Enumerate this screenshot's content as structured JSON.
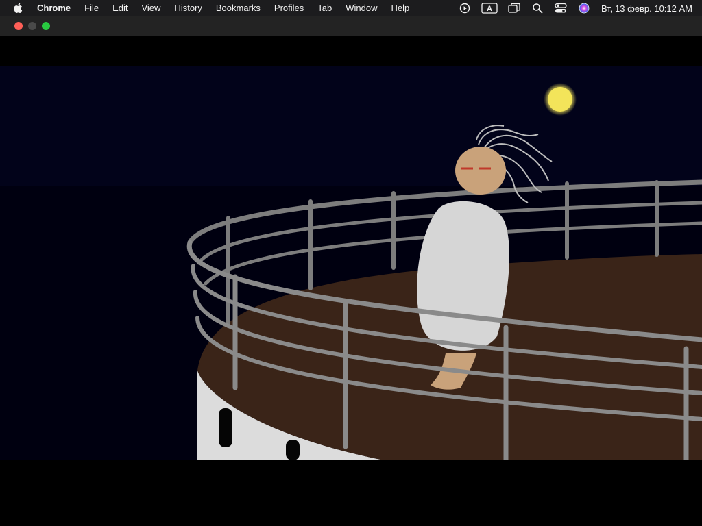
{
  "menubar": {
    "apple_icon": "apple-logo-icon",
    "app_name": "Chrome",
    "items": [
      "File",
      "Edit",
      "View",
      "History",
      "Bookmarks",
      "Profiles",
      "Tab",
      "Window",
      "Help"
    ],
    "status_icons": [
      "play-circle-icon",
      "keyboard-input-icon",
      "screen-mirroring-icon",
      "search-icon",
      "control-center-icon",
      "siri-icon"
    ],
    "input_indicator": "A",
    "clock": "Вт, 13 февр.  10:12 AM"
  },
  "window": {
    "traffic_lights": {
      "close": "#ff5f57",
      "minimize": "#4a4a4a",
      "zoom": "#28c840"
    }
  },
  "scene": {
    "description_icon": "titanic-ship-bow-scene",
    "colors": {
      "sky": "#02031a",
      "moon": "#f3e45a",
      "deck": "#3b2518",
      "hull": "#d9d9d9",
      "railing": "#8a8a8a",
      "figure_dress": "#d8d8d8",
      "figure_skin": "#caa27a"
    }
  }
}
